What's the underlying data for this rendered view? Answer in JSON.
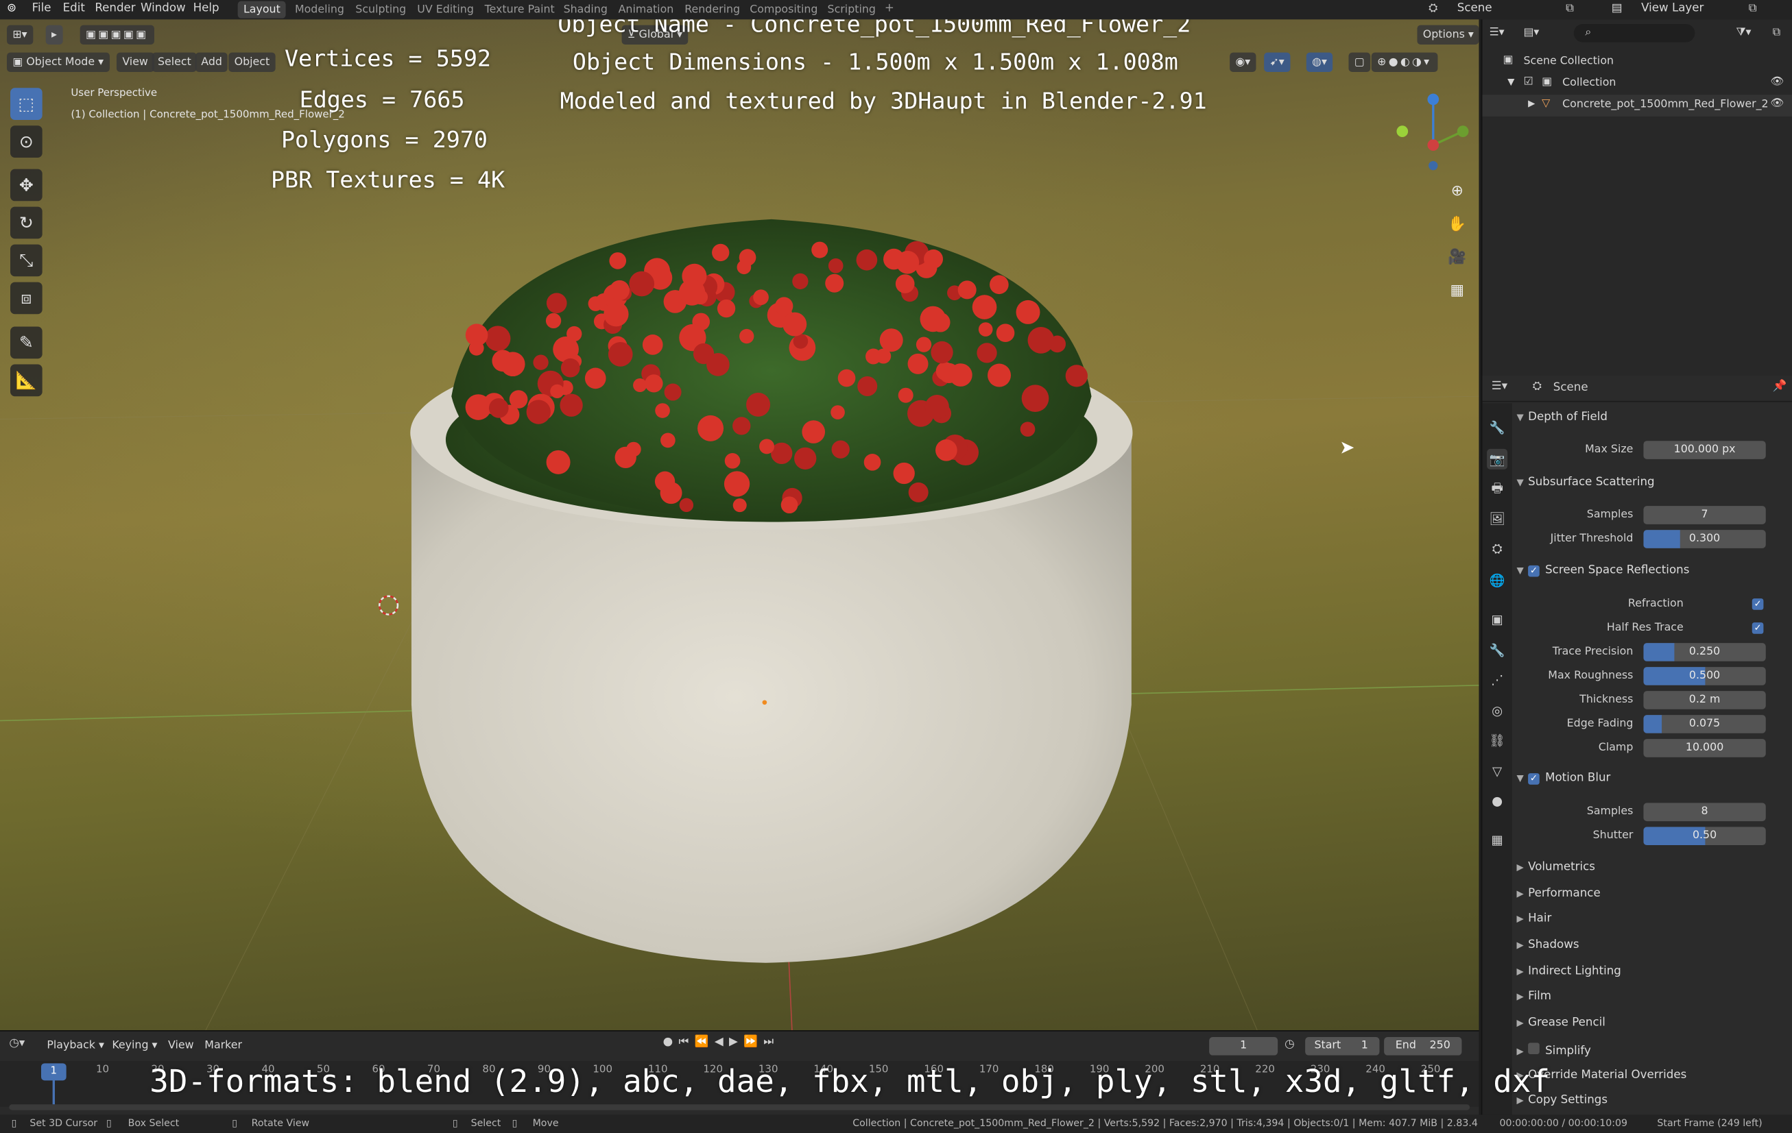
{
  "topbar": {
    "menus": [
      "File",
      "Edit",
      "Render",
      "Window",
      "Help"
    ],
    "workspaces": [
      "Layout",
      "Modeling",
      "Sculpting",
      "UV Editing",
      "Texture Paint",
      "Shading",
      "Animation",
      "Rendering",
      "Compositing",
      "Scripting"
    ],
    "scene_label": "Scene",
    "view_layer_label": "View Layer"
  },
  "viewport": {
    "mode": "Object Mode",
    "menus": [
      "View",
      "Select",
      "Add",
      "Object"
    ],
    "orientation": "Global",
    "options_label": "Options",
    "perspective_label": "User Perspective",
    "collection_path": "(1) Collection | Concrete_pot_1500mm_Red_Flower_2"
  },
  "overlay": {
    "vertices": "Vertices = 5592",
    "edges": "Edges = 7665",
    "polygons": "Polygons = 2970",
    "pbr": "PBR Textures = 4K",
    "object_name": "Object Name - Concrete_pot_1500mm_Red_Flower_2",
    "object_dimensions": "Object Dimensions -  1.500m x 1.500m x 1.008m",
    "modeled_by": "Modeled and textured by 3DHaupt in Blender-2.91",
    "formats": "3D-formats: blend (2.9), abc, dae, fbx, mtl, obj, ply, stl, x3d, gltf, dxf"
  },
  "outliner": {
    "scene_collection": "Scene Collection",
    "collection": "Collection",
    "object": "Concrete_pot_1500mm_Red_Flower_2"
  },
  "properties": {
    "header": "Scene",
    "depth_of_field": {
      "title": "Depth of Field",
      "max_size_label": "Max Size",
      "max_size": "100.000 px"
    },
    "sss": {
      "title": "Subsurface Scattering",
      "samples_label": "Samples",
      "samples": "7",
      "jitter_label": "Jitter Threshold",
      "jitter": "0.300",
      "jitter_frac": 0.3
    },
    "ssr": {
      "title": "Screen Space Reflections",
      "refraction_label": "Refraction",
      "half_res_label": "Half Res Trace",
      "trace_precision_label": "Trace Precision",
      "trace_precision": "0.250",
      "trace_precision_frac": 0.25,
      "max_roughness_label": "Max Roughness",
      "max_roughness": "0.500",
      "max_roughness_frac": 0.5,
      "thickness_label": "Thickness",
      "thickness": "0.2 m",
      "edge_fading_label": "Edge Fading",
      "edge_fading": "0.075",
      "edge_fading_frac": 0.15,
      "clamp_label": "Clamp",
      "clamp": "10.000"
    },
    "motion_blur": {
      "title": "Motion Blur",
      "samples_label": "Samples",
      "samples": "8",
      "shutter_label": "Shutter",
      "shutter": "0.50",
      "shutter_frac": 0.5
    },
    "collapsed_sections": [
      "Volumetrics",
      "Performance",
      "Hair",
      "Shadows",
      "Indirect Lighting",
      "Film",
      "Grease Pencil",
      "Simplify",
      "Override Material Overrides",
      "Copy Settings"
    ]
  },
  "timeline": {
    "menus": [
      "Playback",
      "Keying",
      "View",
      "Marker"
    ],
    "current_frame": "1",
    "start_label": "Start",
    "start": "1",
    "end_label": "End",
    "end": "250",
    "ticks": [
      "10",
      "20",
      "30",
      "40",
      "50",
      "60",
      "70",
      "80",
      "90",
      "100",
      "110",
      "120",
      "130",
      "140",
      "150",
      "160",
      "170",
      "180",
      "190",
      "200",
      "210",
      "220",
      "230",
      "240",
      "250"
    ],
    "playhead": "1"
  },
  "statusbar": {
    "left": [
      "Set 3D Cursor",
      "Box Select",
      "Rotate View",
      "Select",
      "Move"
    ],
    "info": "Collection | Concrete_pot_1500mm_Red_Flower_2 | Verts:5,592 | Faces:2,970 | Tris:4,394 | Objects:0/1 | Mem: 407.7 MiB | 2.83.4",
    "time": "00:00:00:00 / 00:00:10:09",
    "frame": "Start Frame (249 left)"
  }
}
